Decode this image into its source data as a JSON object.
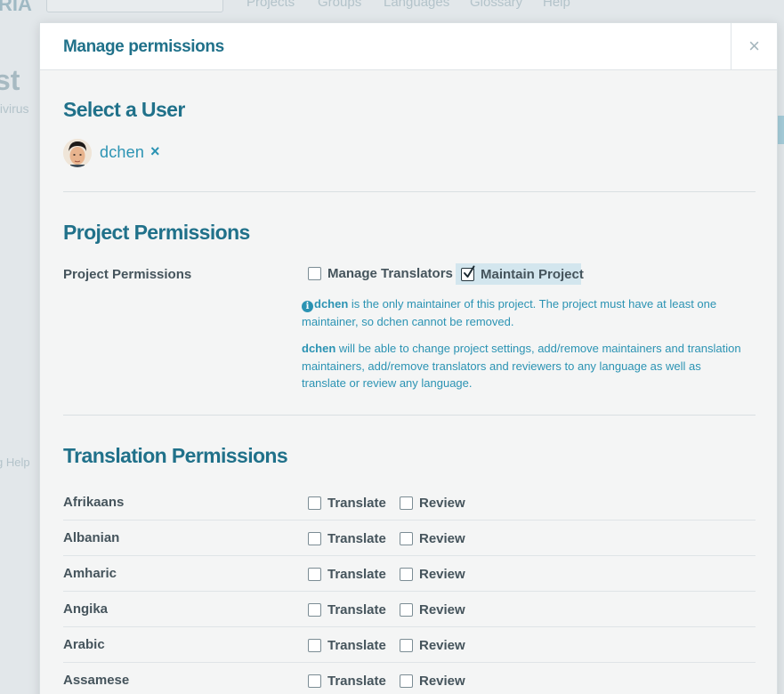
{
  "background": {
    "logo": "RIA",
    "nav": [
      "Projects",
      "Groups",
      "Languages",
      "Glossary",
      "Help"
    ],
    "title": "st",
    "subtitle": "tivirus",
    "footer_text": "g   Help"
  },
  "modal": {
    "title": "Manage permissions",
    "close_glyph": "×"
  },
  "user_section": {
    "title": "Select a User",
    "user_name": "dchen",
    "remove_glyph": "×"
  },
  "project_permissions": {
    "title": "Project Permissions",
    "row_label": "Project Permissions",
    "options": [
      {
        "label": "Manage Translators",
        "checked": false
      },
      {
        "label": "Maintain Project",
        "checked": true
      }
    ],
    "note1_user": "dchen",
    "note1_text": " is the only maintainer of this project. The project must have at least one maintainer, so dchen cannot be removed.",
    "note2_user": "dchen",
    "note2_text": " will be able to change project settings, add/remove maintainers and translation maintainers, add/remove translators and reviewers to any language as well as translate or review any language."
  },
  "translation_permissions": {
    "title": "Translation Permissions",
    "translate_label": "Translate",
    "review_label": "Review",
    "languages": [
      {
        "name": "Afrikaans",
        "translate": false,
        "review": false
      },
      {
        "name": "Albanian",
        "translate": false,
        "review": false
      },
      {
        "name": "Amharic",
        "translate": false,
        "review": false
      },
      {
        "name": "Angika",
        "translate": false,
        "review": false
      },
      {
        "name": "Arabic",
        "translate": false,
        "review": false
      },
      {
        "name": "Assamese",
        "translate": false,
        "review": false
      }
    ]
  },
  "colors": {
    "accent": "#2b93b3",
    "heading": "#20718a",
    "label": "#45545c",
    "highlight": "#d3e6ee"
  }
}
